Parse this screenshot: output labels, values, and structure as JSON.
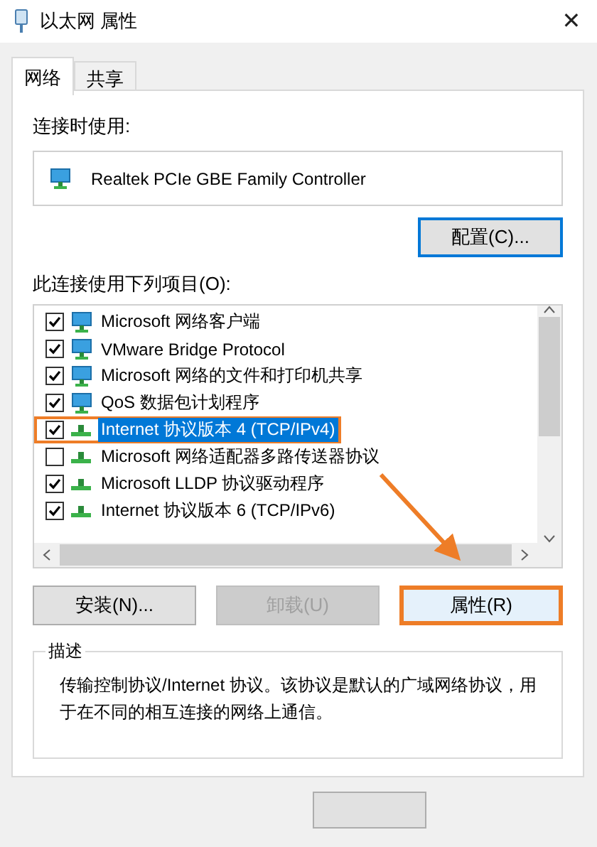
{
  "window": {
    "title": "以太网 属性",
    "close": "✕"
  },
  "tabs": [
    {
      "label": "网络",
      "selected": true
    },
    {
      "label": "共享",
      "selected": false
    }
  ],
  "connect_using": {
    "label": "连接时使用:",
    "adapter": "Realtek PCIe GBE Family Controller",
    "configure_button": "配置(C)..."
  },
  "items": {
    "label": "此连接使用下列项目(O):",
    "rows": [
      {
        "kind": "client",
        "text": "Microsoft 网络客户端",
        "checked": true,
        "selected": false,
        "highlighted": false
      },
      {
        "kind": "service",
        "text": "VMware Bridge Protocol",
        "checked": true,
        "selected": false,
        "highlighted": false
      },
      {
        "kind": "service",
        "text": "Microsoft 网络的文件和打印机共享",
        "checked": true,
        "selected": false,
        "highlighted": false
      },
      {
        "kind": "service",
        "text": "QoS 数据包计划程序",
        "checked": true,
        "selected": false,
        "highlighted": false
      },
      {
        "kind": "protocol",
        "text": "Internet 协议版本 4 (TCP/IPv4)",
        "checked": true,
        "selected": true,
        "highlighted": true
      },
      {
        "kind": "protocol",
        "text": "Microsoft 网络适配器多路传送器协议",
        "checked": false,
        "selected": false,
        "highlighted": false
      },
      {
        "kind": "protocol",
        "text": "Microsoft LLDP 协议驱动程序",
        "checked": true,
        "selected": false,
        "highlighted": false
      },
      {
        "kind": "protocol",
        "text": "Internet 协议版本 6 (TCP/IPv6)",
        "checked": true,
        "selected": false,
        "highlighted": false
      }
    ]
  },
  "buttons": [
    {
      "label": "安装(N)...",
      "disabled": false,
      "highlighted": false
    },
    {
      "label": "卸载(U)",
      "disabled": true,
      "highlighted": false
    },
    {
      "label": "属性(R)",
      "disabled": false,
      "highlighted": true
    }
  ],
  "description": {
    "legend": "描述",
    "text": "传输控制协议/Internet 协议。该协议是默认的广域网络协议，用于在不同的相互连接的网络上通信。"
  }
}
